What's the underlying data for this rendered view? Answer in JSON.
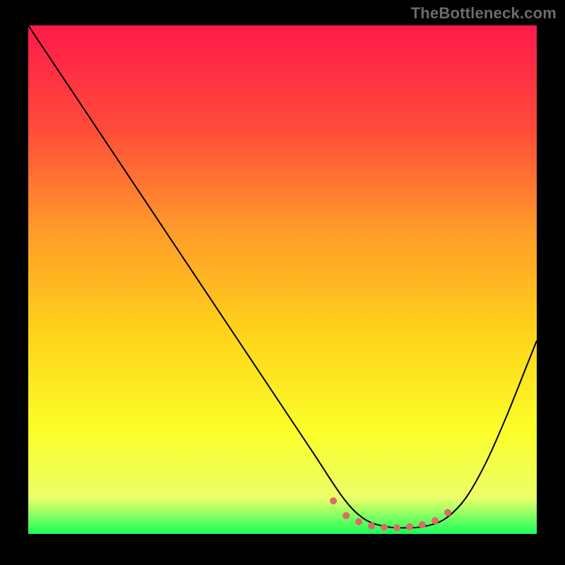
{
  "watermark": {
    "text": "TheBottleneck.com"
  },
  "chart_data": {
    "type": "line",
    "title": "",
    "xlabel": "",
    "ylabel": "",
    "xlim": [
      0,
      100
    ],
    "ylim": [
      0,
      100
    ],
    "background_gradient": {
      "stops": [
        {
          "offset": 0.0,
          "color": "#ff1a4b"
        },
        {
          "offset": 0.2,
          "color": "#ff4a3a"
        },
        {
          "offset": 0.4,
          "color": "#ff9a2a"
        },
        {
          "offset": 0.6,
          "color": "#ffd21a"
        },
        {
          "offset": 0.8,
          "color": "#fbff2a"
        },
        {
          "offset": 0.93,
          "color": "#eaff6a"
        },
        {
          "offset": 1.0,
          "color": "#18ff5a"
        }
      ]
    },
    "series": [
      {
        "name": "bottleneck-curve",
        "color": "#000000",
        "stroke_width": 2,
        "x": [
          0,
          8,
          16,
          24,
          32,
          40,
          48,
          56,
          62,
          66,
          70,
          74,
          78,
          82,
          86,
          90,
          94,
          98,
          100
        ],
        "y": [
          100,
          88,
          76,
          64,
          52,
          40,
          28,
          16,
          7,
          3,
          1.5,
          1.2,
          1.5,
          3,
          7,
          14,
          23,
          33,
          38
        ]
      }
    ],
    "marker": {
      "name": "optimal-region-dots",
      "color": "#dd6a68",
      "dot_radius": 5,
      "x": [
        60,
        62.5,
        65,
        67.5,
        70,
        72.5,
        75,
        77.5,
        80,
        82.5
      ],
      "y": [
        6.5,
        3.6,
        2.4,
        1.6,
        1.3,
        1.2,
        1.4,
        1.8,
        2.6,
        4.2
      ]
    },
    "grid": false,
    "legend": null
  }
}
